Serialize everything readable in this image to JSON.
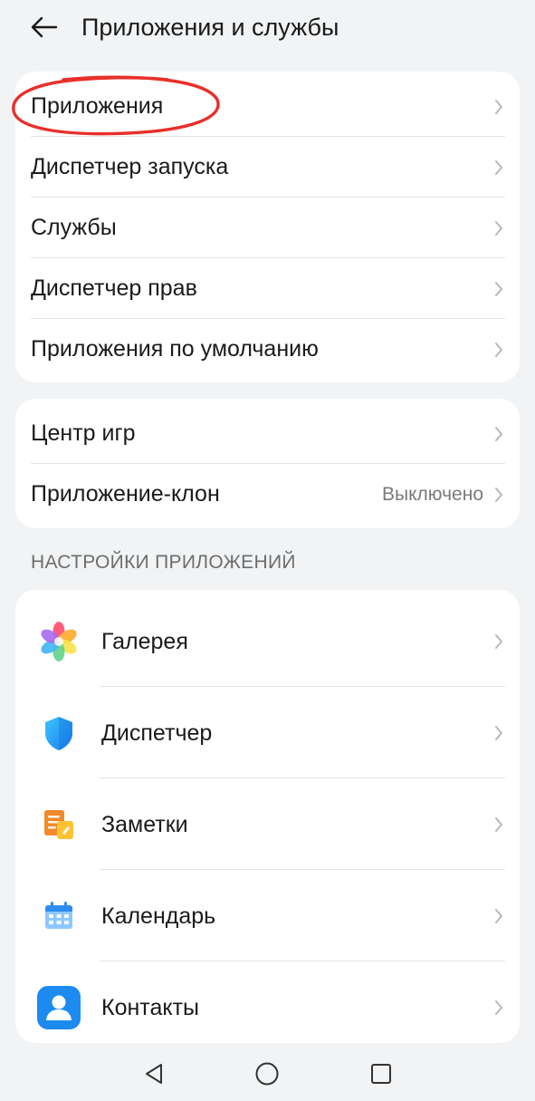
{
  "header": {
    "title": "Приложения и службы",
    "back_icon": "arrow-left-icon"
  },
  "group1": {
    "items": [
      {
        "label": "Приложения"
      },
      {
        "label": "Диспетчер запуска"
      },
      {
        "label": "Службы"
      },
      {
        "label": "Диспетчер прав"
      },
      {
        "label": "Приложения по умолчанию"
      }
    ]
  },
  "group2": {
    "items": [
      {
        "label": "Центр игр"
      },
      {
        "label": "Приложение-клон",
        "value": "Выключено"
      }
    ]
  },
  "app_settings": {
    "section_title": "НАСТРОЙКИ ПРИЛОЖЕНИЙ",
    "items": [
      {
        "label": "Галерея",
        "icon": "gallery-icon"
      },
      {
        "label": "Диспетчер",
        "icon": "shield-icon"
      },
      {
        "label": "Заметки",
        "icon": "notes-icon"
      },
      {
        "label": "Календарь",
        "icon": "calendar-icon"
      },
      {
        "label": "Контакты",
        "icon": "contacts-icon"
      }
    ]
  },
  "navigation": {
    "back_icon": "triangle-back-icon",
    "home_icon": "circle-home-icon",
    "recents_icon": "square-recents-icon"
  },
  "colors": {
    "background": "#f1f3f5",
    "card": "#ffffff",
    "highlight": "#e8302a",
    "secondary_text": "#7a7a7a"
  }
}
